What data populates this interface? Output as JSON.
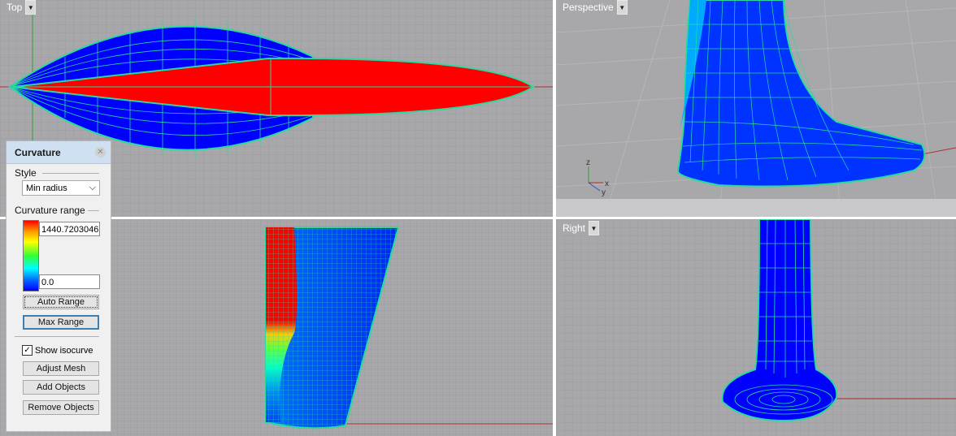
{
  "viewports": {
    "top": {
      "label": "Top",
      "menu_icon": "triangle-down"
    },
    "perspective": {
      "label": "Perspective",
      "menu_icon": "triangle-down"
    },
    "right": {
      "label": "Right",
      "menu_icon": "triangle-down"
    }
  },
  "axis_labels": {
    "z": "z",
    "x": "x",
    "y": "y"
  },
  "curvature_panel": {
    "title": "Curvature",
    "close_icon": "close-circle",
    "style_label": "Style",
    "style_value": "Min radius",
    "range_label": "Curvature range",
    "range_max": "1440.7203046",
    "range_min": "0.0",
    "auto_range": "Auto Range",
    "max_range": "Max Range",
    "show_isocurve": "Show isocurve",
    "show_isocurve_checked": "✓",
    "adjust_mesh": "Adjust Mesh",
    "add_objects": "Add Objects",
    "remove_objects": "Remove Objects"
  },
  "colors": {
    "viewport_bg": "#a8a8ab",
    "surface_blue": "#0000ff",
    "curvature_red": "#ff0000",
    "isocurve": "#29d9a0",
    "x_axis": "#b03030",
    "y_axis": "#2fa02f"
  }
}
